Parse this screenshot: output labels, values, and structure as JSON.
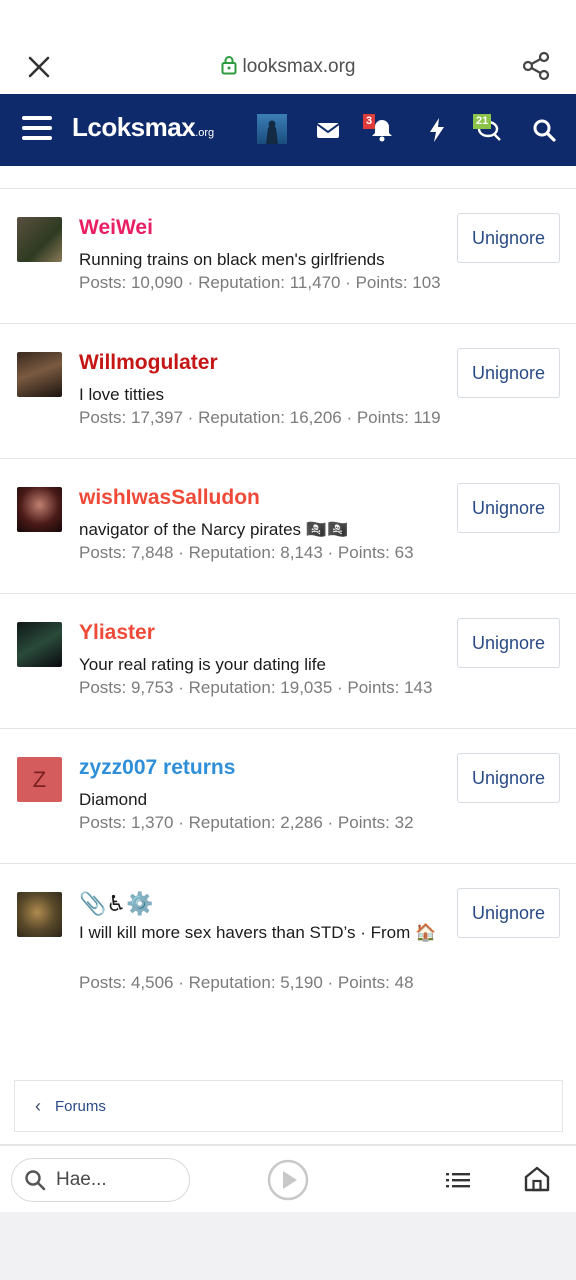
{
  "browser": {
    "url": "looksmax.org",
    "icons": {
      "close": "close-icon",
      "lock": "lock-icon",
      "share": "share-icon"
    }
  },
  "header": {
    "logo": "Lcoksmax",
    "logo_suffix": ".org",
    "alerts_count": "3",
    "conversations_count": "21",
    "colors": {
      "bar": "#0f2a6b",
      "alert_badge": "#e03a3a",
      "conv_badge": "#8bc34a"
    }
  },
  "members": [
    {
      "name": "WeiWei",
      "name_color": "#e91e63",
      "title": "Running trains on black men's girlfriends",
      "stats": "Posts: 10,090 · Reputation: 11,470 · Points: 103",
      "button": "Unignore"
    },
    {
      "name": "Willmogulater",
      "name_color": "#c51616",
      "title": "I love titties",
      "stats": "Posts: 17,397 · Reputation: 16,206 · Points: 119",
      "button": "Unignore"
    },
    {
      "name": "wishIwasSalludon",
      "name_color": "#ef4a38",
      "title": "navigator of the Narcy pirates 🏴‍☠️🏴‍☠️",
      "stats": "Posts: 7,848 · Reputation: 8,143 · Points: 63",
      "button": "Unignore"
    },
    {
      "name": "Yliaster",
      "name_color": "#ef4a38",
      "title": "Your real rating is your dating life",
      "stats": "Posts: 9,753 · Reputation: 19,035 · Points: 143",
      "button": "Unignore"
    },
    {
      "name": "zyzz007 returns",
      "name_color": "#2f8fd8",
      "avatar_letter": "Z",
      "title": "Diamond",
      "stats": "Posts: 1,370 · Reputation: 2,286 · Points: 32",
      "button": "Unignore"
    },
    {
      "name": "📎♿⚙️",
      "name_color": "#1b1b1b",
      "title": "I will kill more sex havers than STD’s · From 🏠",
      "stats": "Posts: 4,506 · Reputation: 5,190 · Points: 48",
      "button": "Unignore"
    }
  ],
  "breadcrumb": {
    "label": "Forums"
  },
  "bottom": {
    "search_text": "Hae..."
  }
}
